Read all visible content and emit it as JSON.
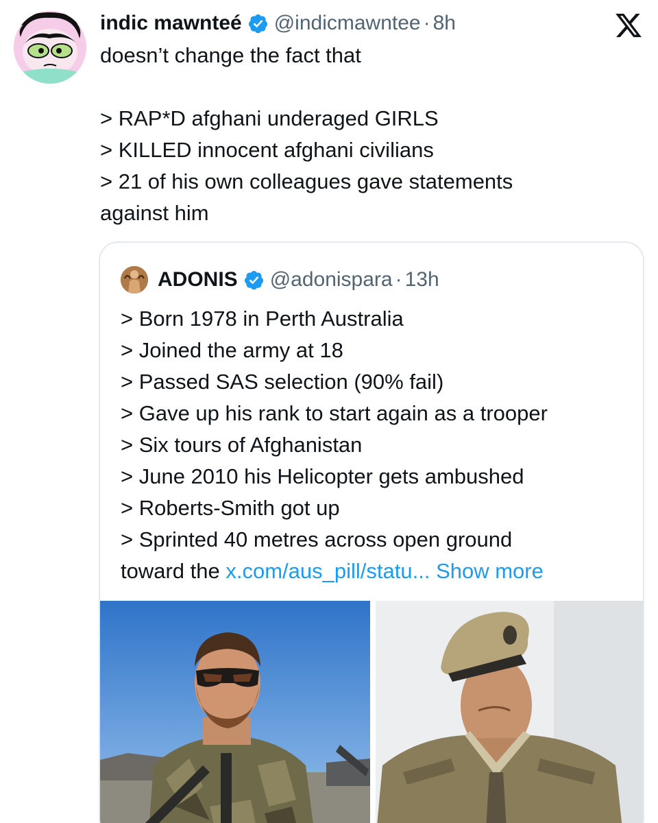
{
  "tweet": {
    "author_name": "indic mawnteé",
    "handle": "@indicmawntee",
    "separator": "·",
    "time": "8h",
    "lines": [
      "doesn’t change the fact that",
      "",
      "> RAP*D afghani underaged GIRLS",
      "> KILLED innocent afghani civilians",
      "> 21 of his own colleagues gave statements",
      "against him"
    ]
  },
  "quote": {
    "author_name": "ADONIS",
    "handle": "@adonispara",
    "separator": "·",
    "time": "13h",
    "lines": [
      "> Born 1978 in Perth Australia",
      "> Joined the army at 18",
      "> Passed SAS selection (90% fail)",
      "> Gave up his rank to start again as a trooper",
      "> Six tours of Afghanistan",
      "> June 2010 his Helicopter gets ambushed",
      "> Roberts-Smith got up",
      "> Sprinted 40 metres across open ground"
    ],
    "last_line_prefix": "toward the ",
    "link_text": "x.com/aus_pill/statu...",
    "show_more": "Show more"
  },
  "icons": {
    "verified": "verified-badge-icon",
    "platform": "x-logo-icon"
  },
  "colors": {
    "text": "#0f1419",
    "secondary": "#536471",
    "link": "#1d9bf0",
    "verified": "#1d9bf0",
    "card_border": "#e6e9ec"
  }
}
